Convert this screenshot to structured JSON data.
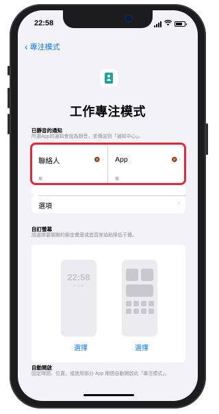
{
  "status_bar": {
    "time": "22:58"
  },
  "nav": {
    "back_label": "專注模式"
  },
  "header": {
    "icon": "person-badge-icon",
    "title": "工作專注模式"
  },
  "silenced_notifications": {
    "heading": "已靜音的通知",
    "description": "所選App的通知會設為靜音，並傳送到「通知中心」。",
    "people": {
      "label": "聯絡人",
      "value": "無"
    },
    "apps": {
      "label": "App",
      "value": "無"
    },
    "options_label": "選項"
  },
  "custom_screens": {
    "heading": "自訂螢幕",
    "description": "請選擇要關聯的鎖定畫面或首頁來協助降低干擾。",
    "lock_screen_time": "22:58",
    "lock_screen_dots": "○○○",
    "choose_lock_label": "選擇",
    "choose_home_label": "選擇"
  },
  "auto_on": {
    "heading": "自動開啟",
    "description": "固定時間、位置，或使用部分 App 期間自動開啟此「專注模式」。"
  },
  "colors": {
    "accent": "#0a7aff",
    "highlight": "#e8253a",
    "focus_icon": "#1ba1a6"
  }
}
